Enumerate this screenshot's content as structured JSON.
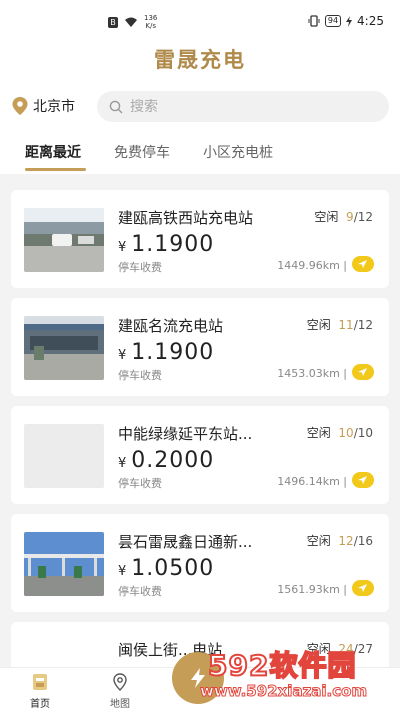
{
  "status_bar": {
    "badge": "B",
    "speed_value": "136",
    "speed_unit": "K/s",
    "battery": "94",
    "time": "4:25"
  },
  "app_title": "雷晟充电",
  "city": "北京市",
  "search": {
    "placeholder": "搜索"
  },
  "tabs": [
    {
      "label": "距离最近",
      "active": true
    },
    {
      "label": "免费停车",
      "active": false
    },
    {
      "label": "小区充电桩",
      "active": false
    }
  ],
  "stations": [
    {
      "name": "建瓯高铁西站充电站",
      "status": "空闲",
      "available": "9",
      "total": "/12",
      "price": "1.1900",
      "fee": "停车收费",
      "distance": "1449.96km |",
      "has_photo": true
    },
    {
      "name": "建瓯名流充电站",
      "status": "空闲",
      "available": "11",
      "total": "/12",
      "price": "1.1900",
      "fee": "停车收费",
      "distance": "1453.03km |",
      "has_photo": true
    },
    {
      "name": "中能绿缘延平东站...",
      "status": "空闲",
      "available": "10",
      "total": "/10",
      "price": "0.2000",
      "fee": "停车收费",
      "distance": "1496.14km |",
      "has_photo": false
    },
    {
      "name": "昙石雷晟鑫日通新...",
      "status": "空闲",
      "available": "12",
      "total": "/16",
      "price": "1.0500",
      "fee": "停车收费",
      "distance": "1561.93km |",
      "has_photo": true
    },
    {
      "name": "闽侯上街...电站",
      "status": "空闲",
      "available": "24",
      "total": "/27"
    }
  ],
  "currency": "¥",
  "bottom_nav": [
    {
      "label": "首页",
      "icon": "home-icon",
      "active": true
    },
    {
      "label": "地图",
      "icon": "map-pin-icon",
      "active": false
    }
  ],
  "watermark": {
    "line1": "592软件园",
    "line2": "www.592xiazai.com"
  },
  "colors": {
    "accent": "#c59d56",
    "nav_button": "#f2c81a",
    "watermark": "#e2453c"
  }
}
